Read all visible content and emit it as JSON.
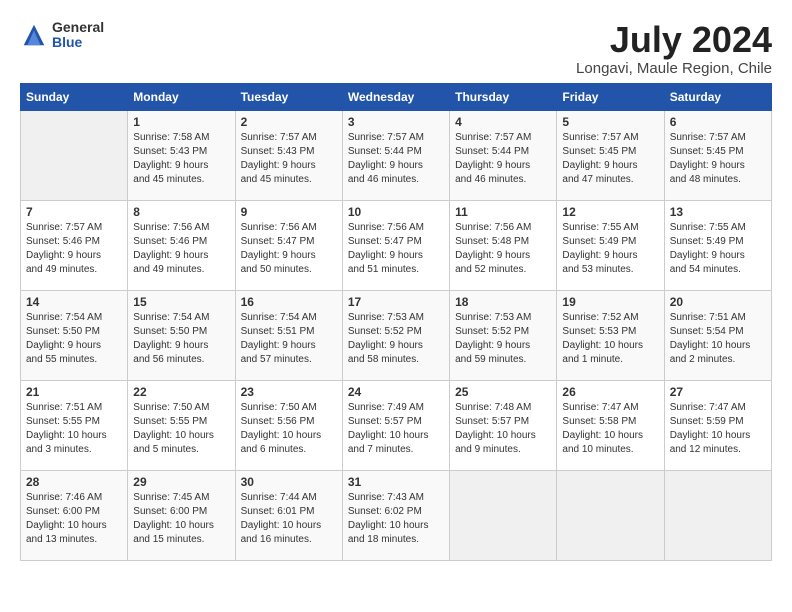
{
  "header": {
    "logo_general": "General",
    "logo_blue": "Blue",
    "month_year": "July 2024",
    "location": "Longavi, Maule Region, Chile"
  },
  "days_of_week": [
    "Sunday",
    "Monday",
    "Tuesday",
    "Wednesday",
    "Thursday",
    "Friday",
    "Saturday"
  ],
  "weeks": [
    [
      {
        "day": "",
        "info": ""
      },
      {
        "day": "1",
        "info": "Sunrise: 7:58 AM\nSunset: 5:43 PM\nDaylight: 9 hours\nand 45 minutes."
      },
      {
        "day": "2",
        "info": "Sunrise: 7:57 AM\nSunset: 5:43 PM\nDaylight: 9 hours\nand 45 minutes."
      },
      {
        "day": "3",
        "info": "Sunrise: 7:57 AM\nSunset: 5:44 PM\nDaylight: 9 hours\nand 46 minutes."
      },
      {
        "day": "4",
        "info": "Sunrise: 7:57 AM\nSunset: 5:44 PM\nDaylight: 9 hours\nand 46 minutes."
      },
      {
        "day": "5",
        "info": "Sunrise: 7:57 AM\nSunset: 5:45 PM\nDaylight: 9 hours\nand 47 minutes."
      },
      {
        "day": "6",
        "info": "Sunrise: 7:57 AM\nSunset: 5:45 PM\nDaylight: 9 hours\nand 48 minutes."
      }
    ],
    [
      {
        "day": "7",
        "info": "Sunrise: 7:57 AM\nSunset: 5:46 PM\nDaylight: 9 hours\nand 49 minutes."
      },
      {
        "day": "8",
        "info": "Sunrise: 7:56 AM\nSunset: 5:46 PM\nDaylight: 9 hours\nand 49 minutes."
      },
      {
        "day": "9",
        "info": "Sunrise: 7:56 AM\nSunset: 5:47 PM\nDaylight: 9 hours\nand 50 minutes."
      },
      {
        "day": "10",
        "info": "Sunrise: 7:56 AM\nSunset: 5:47 PM\nDaylight: 9 hours\nand 51 minutes."
      },
      {
        "day": "11",
        "info": "Sunrise: 7:56 AM\nSunset: 5:48 PM\nDaylight: 9 hours\nand 52 minutes."
      },
      {
        "day": "12",
        "info": "Sunrise: 7:55 AM\nSunset: 5:49 PM\nDaylight: 9 hours\nand 53 minutes."
      },
      {
        "day": "13",
        "info": "Sunrise: 7:55 AM\nSunset: 5:49 PM\nDaylight: 9 hours\nand 54 minutes."
      }
    ],
    [
      {
        "day": "14",
        "info": "Sunrise: 7:54 AM\nSunset: 5:50 PM\nDaylight: 9 hours\nand 55 minutes."
      },
      {
        "day": "15",
        "info": "Sunrise: 7:54 AM\nSunset: 5:50 PM\nDaylight: 9 hours\nand 56 minutes."
      },
      {
        "day": "16",
        "info": "Sunrise: 7:54 AM\nSunset: 5:51 PM\nDaylight: 9 hours\nand 57 minutes."
      },
      {
        "day": "17",
        "info": "Sunrise: 7:53 AM\nSunset: 5:52 PM\nDaylight: 9 hours\nand 58 minutes."
      },
      {
        "day": "18",
        "info": "Sunrise: 7:53 AM\nSunset: 5:52 PM\nDaylight: 9 hours\nand 59 minutes."
      },
      {
        "day": "19",
        "info": "Sunrise: 7:52 AM\nSunset: 5:53 PM\nDaylight: 10 hours\nand 1 minute."
      },
      {
        "day": "20",
        "info": "Sunrise: 7:51 AM\nSunset: 5:54 PM\nDaylight: 10 hours\nand 2 minutes."
      }
    ],
    [
      {
        "day": "21",
        "info": "Sunrise: 7:51 AM\nSunset: 5:55 PM\nDaylight: 10 hours\nand 3 minutes."
      },
      {
        "day": "22",
        "info": "Sunrise: 7:50 AM\nSunset: 5:55 PM\nDaylight: 10 hours\nand 5 minutes."
      },
      {
        "day": "23",
        "info": "Sunrise: 7:50 AM\nSunset: 5:56 PM\nDaylight: 10 hours\nand 6 minutes."
      },
      {
        "day": "24",
        "info": "Sunrise: 7:49 AM\nSunset: 5:57 PM\nDaylight: 10 hours\nand 7 minutes."
      },
      {
        "day": "25",
        "info": "Sunrise: 7:48 AM\nSunset: 5:57 PM\nDaylight: 10 hours\nand 9 minutes."
      },
      {
        "day": "26",
        "info": "Sunrise: 7:47 AM\nSunset: 5:58 PM\nDaylight: 10 hours\nand 10 minutes."
      },
      {
        "day": "27",
        "info": "Sunrise: 7:47 AM\nSunset: 5:59 PM\nDaylight: 10 hours\nand 12 minutes."
      }
    ],
    [
      {
        "day": "28",
        "info": "Sunrise: 7:46 AM\nSunset: 6:00 PM\nDaylight: 10 hours\nand 13 minutes."
      },
      {
        "day": "29",
        "info": "Sunrise: 7:45 AM\nSunset: 6:00 PM\nDaylight: 10 hours\nand 15 minutes."
      },
      {
        "day": "30",
        "info": "Sunrise: 7:44 AM\nSunset: 6:01 PM\nDaylight: 10 hours\nand 16 minutes."
      },
      {
        "day": "31",
        "info": "Sunrise: 7:43 AM\nSunset: 6:02 PM\nDaylight: 10 hours\nand 18 minutes."
      },
      {
        "day": "",
        "info": ""
      },
      {
        "day": "",
        "info": ""
      },
      {
        "day": "",
        "info": ""
      }
    ]
  ]
}
